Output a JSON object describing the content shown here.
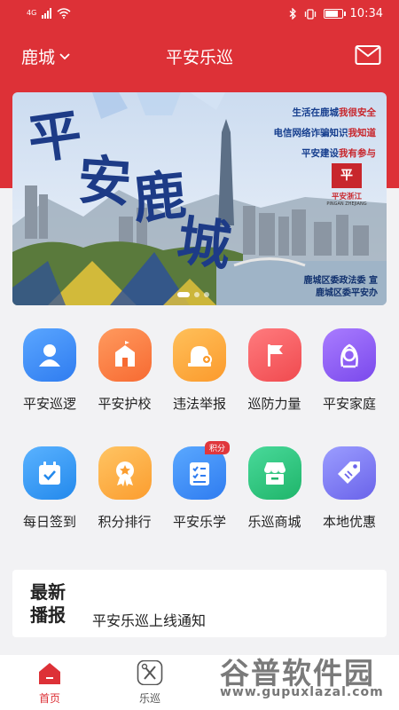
{
  "status_bar": {
    "network": "4G",
    "time": "10:34"
  },
  "header": {
    "city": "鹿城",
    "title": "平安乐巡"
  },
  "banner": {
    "art_title": [
      "平",
      "安",
      "鹿",
      "城"
    ],
    "slogans": [
      {
        "pre": "生活在鹿城",
        "em": "我很安全"
      },
      {
        "pre": "电信网络诈骗知识",
        "em": "我知道"
      },
      {
        "pre": "平安建设",
        "em": "我有参与"
      }
    ],
    "seal_name": "平安浙江",
    "seal_pinyin": "PINGAN ZHEJIANG",
    "footer": [
      "鹿城区委政法委 宣",
      "鹿城区委平安办"
    ]
  },
  "grid": {
    "row1": [
      {
        "label": "平安巡逻",
        "icon": "patrol-person-icon",
        "color": "#3b8cf5"
      },
      {
        "label": "平安护校",
        "icon": "school-icon",
        "color": "#fb7a3f"
      },
      {
        "label": "违法举报",
        "icon": "alarm-report-icon",
        "color": "#fba33a"
      },
      {
        "label": "巡防力量",
        "icon": "flag-icon",
        "color": "#f45a5e"
      },
      {
        "label": "平安家庭",
        "icon": "family-icon",
        "color": "#8c5cf3"
      }
    ],
    "row2": [
      {
        "label": "每日签到",
        "icon": "calendar-check-icon",
        "color": "#2f93f0"
      },
      {
        "label": "积分排行",
        "icon": "medal-icon",
        "color": "#fba83b"
      },
      {
        "label": "平安乐学",
        "icon": "checklist-icon",
        "color": "#3a8df5",
        "badge": "积分"
      },
      {
        "label": "乐巡商城",
        "icon": "shop-icon",
        "color": "#2cc27a"
      },
      {
        "label": "本地优惠",
        "icon": "tag-icon",
        "color": "#7a7cf0"
      }
    ]
  },
  "news": {
    "tag_line1": "最新",
    "tag_line2": "播报",
    "headline": "平安乐巡上线通知"
  },
  "tabbar": [
    {
      "label": "首页",
      "icon": "home-icon",
      "active": true
    },
    {
      "label": "乐巡",
      "icon": "tools-icon",
      "active": false
    }
  ],
  "watermark": {
    "text": "谷普软件园",
    "url": "www.gupuxlazal.com"
  },
  "colors": {
    "brand_red": "#dd3137",
    "page_bg": "#f2f2f4"
  }
}
